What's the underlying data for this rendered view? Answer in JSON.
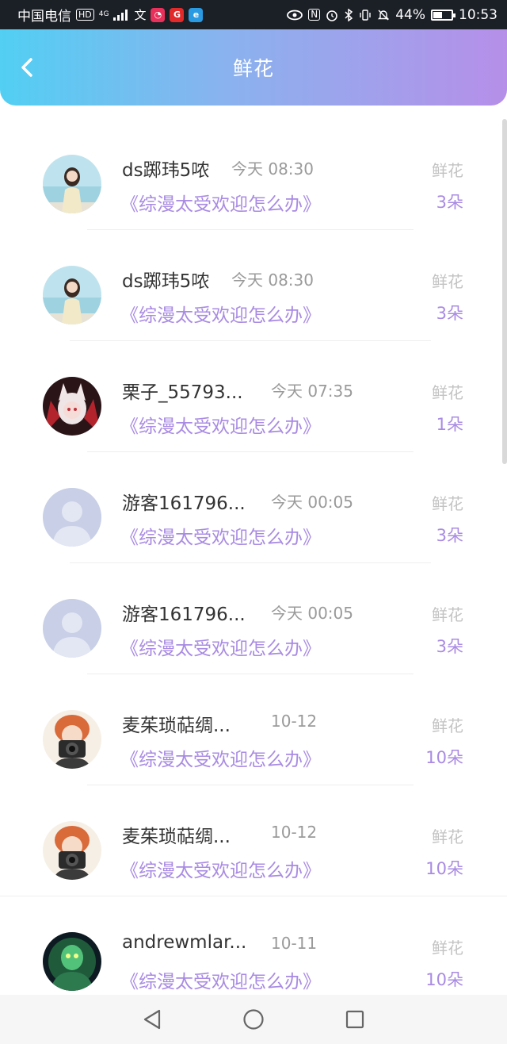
{
  "status_bar": {
    "carrier": "中国电信",
    "hd": "HD",
    "network": "4G",
    "battery_percent": "44%",
    "time": "10:53"
  },
  "header": {
    "title": "鲜花",
    "back_icon": "chevron-left-icon",
    "gradient": [
      "#52cff3",
      "#b68fe9"
    ]
  },
  "colors": {
    "accent": "#a98be3",
    "muted": "#9a9a9a"
  },
  "items": [
    {
      "name": "ds踯玮5哝",
      "time": "今天 08:30",
      "book": "《综漫太受欢迎怎么办》",
      "kind": "鲜花",
      "count": "3朵",
      "avatar": "girl-beach"
    },
    {
      "name": "ds踯玮5哝",
      "time": "今天 08:30",
      "book": "《综漫太受欢迎怎么办》",
      "kind": "鲜花",
      "count": "3朵",
      "avatar": "girl-beach"
    },
    {
      "name": "栗子_55793...",
      "time": "今天 07:35",
      "book": "《综漫太受欢迎怎么办》",
      "kind": "鲜花",
      "count": "1朵",
      "avatar": "anime-catgirl"
    },
    {
      "name": "游客161796...",
      "time": "今天 00:05",
      "book": "《综漫太受欢迎怎么办》",
      "kind": "鲜花",
      "count": "3朵",
      "avatar": "default-user"
    },
    {
      "name": "游客161796...",
      "time": "今天 00:05",
      "book": "《综漫太受欢迎怎么办》",
      "kind": "鲜花",
      "count": "3朵",
      "avatar": "default-user"
    },
    {
      "name": "麦茱琐萜绸...",
      "time": "10-12",
      "book": "《综漫太受欢迎怎么办》",
      "kind": "鲜花",
      "count": "10朵",
      "avatar": "anime-camera"
    },
    {
      "name": "麦茱琐萜绸...",
      "time": "10-12",
      "book": "《综漫太受欢迎怎么办》",
      "kind": "鲜花",
      "count": "10朵",
      "avatar": "anime-camera"
    },
    {
      "name": "andrewmlar...",
      "time": "10-11",
      "book": "《综漫太受欢迎怎么办》",
      "kind": "鲜花",
      "count": "10朵",
      "avatar": "green-creature"
    }
  ],
  "nav": {
    "back_icon": "triangle-back-icon",
    "home_icon": "circle-home-icon",
    "recent_icon": "square-recent-icon"
  }
}
